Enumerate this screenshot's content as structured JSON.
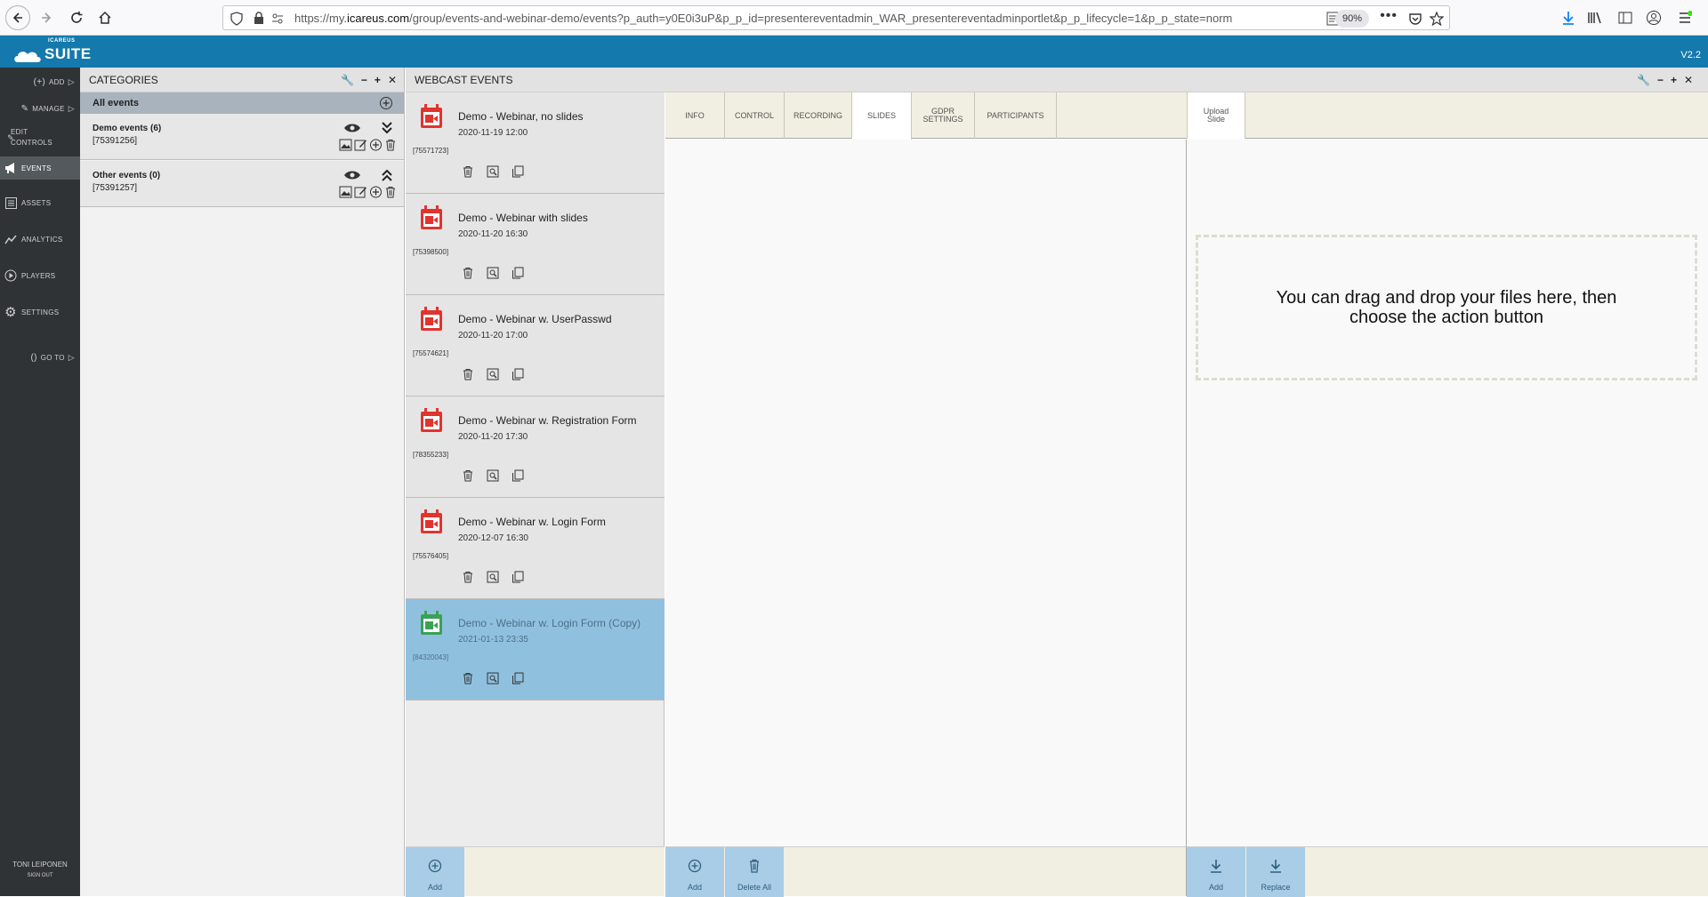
{
  "browser": {
    "url_prefix": "https://my.",
    "url_domain": "icareus.com",
    "url_rest": "/group/events-and-webinar-demo/events?p_auth=y0E0i3uP&p_p_id=presentereventadmin_WAR_presentereventadminportlet&p_p_lifecycle=1&p_p_state=norm",
    "zoom": "90%"
  },
  "app": {
    "logo_small": "ICAREUS",
    "logo_main": "SUITE",
    "version": "V2.2"
  },
  "leftnav": {
    "items": [
      {
        "label": "ADD",
        "icon": "add-icon"
      },
      {
        "label": "MANAGE",
        "icon": "manage-icon"
      },
      {
        "label": "EDIT CONTROLS",
        "icon": "edit-icon"
      },
      {
        "label": "EVENTS",
        "icon": "megaphone-icon",
        "active": true
      },
      {
        "label": "ASSETS",
        "icon": "assets-icon"
      },
      {
        "label": "ANALYTICS",
        "icon": "analytics-icon"
      },
      {
        "label": "PLAYERS",
        "icon": "play-icon"
      },
      {
        "label": "SETTINGS",
        "icon": "gear-icon"
      },
      {
        "label": "GO TO",
        "icon": "goto-icon"
      }
    ],
    "user_name": "TONI LEIPONEN",
    "sign_out": "SIGN OUT"
  },
  "categories": {
    "title": "CATEGORIES",
    "all_events": "All events",
    "items": [
      {
        "name": "Demo events (6)",
        "id": "[75391256]"
      },
      {
        "name": "Other events (0)",
        "id": "[75391257]"
      }
    ]
  },
  "webcast": {
    "title": "WEBCAST EVENTS",
    "events": [
      {
        "title": "Demo - Webinar, no slides",
        "date": "2020-11-19 12:00",
        "id": "[75571723]"
      },
      {
        "title": "Demo - Webinar with slides",
        "date": "2020-11-20 16:30",
        "id": "[75398500]"
      },
      {
        "title": "Demo - Webinar w. UserPasswd",
        "date": "2020-11-20 17:00",
        "id": "[75574621]"
      },
      {
        "title": "Demo - Webinar w. Registration Form",
        "date": "2020-11-20 17:30",
        "id": "[78355233]"
      },
      {
        "title": "Demo - Webinar w. Login Form",
        "date": "2020-12-07 16:30",
        "id": "[75576405]"
      },
      {
        "title": "Demo - Webinar w. Login Form (Copy)",
        "date": "2021-01-13 23:35",
        "id": "[84320043]",
        "selected": true
      }
    ]
  },
  "tabs": {
    "info": "INFO",
    "control": "CONTROL",
    "recording": "RECORDING",
    "slides": "SLIDES",
    "gdpr_1": "GDPR",
    "gdpr_2": "SETTINGS",
    "participants": "PARTICIPANTS",
    "active": "SLIDES"
  },
  "upload": {
    "tab_1": "Upload",
    "tab_2": "Slide",
    "drop_text": "You can drag and drop your files here, then choose the action button"
  },
  "footer": {
    "events_add": "Add",
    "slides_add": "Add",
    "slides_delete_all": "Delete All",
    "upload_add": "Add",
    "upload_replace": "Replace"
  },
  "colors": {
    "header_blue": "#1479ac",
    "nav_dark": "#2f3336",
    "selected_event": "#8fc1df",
    "calendar_red": "#e0342f",
    "calendar_green": "#3aa157",
    "footer_button": "#a9cde6"
  }
}
